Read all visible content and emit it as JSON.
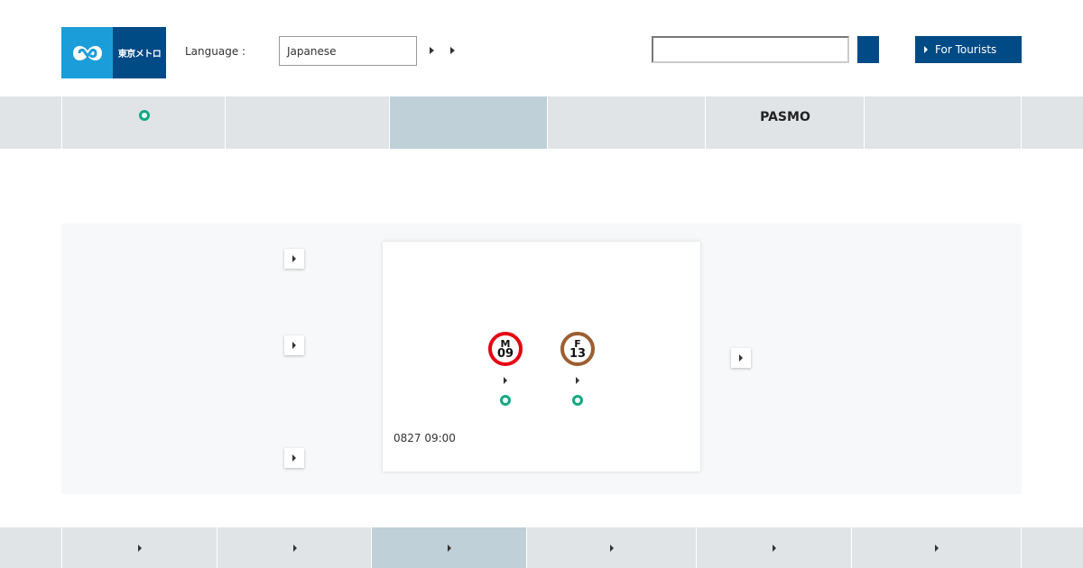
{
  "header": {
    "logo_text": "東京メトロ",
    "language_label": "Language :",
    "language_value": "Japanese",
    "search_value": "",
    "tourist_label": "For Tourists"
  },
  "nav": {
    "items": [
      {
        "label": "",
        "icon": "ring-icon"
      },
      {
        "label": ""
      },
      {
        "label": "",
        "active": true
      },
      {
        "label": ""
      },
      {
        "label": "PASMO"
      },
      {
        "label": ""
      }
    ]
  },
  "card": {
    "stations": [
      {
        "line": "M",
        "number": "09",
        "color": "#e60012"
      },
      {
        "line": "F",
        "number": "13",
        "color": "#9c5e31"
      }
    ],
    "timestamp": "0827 09:00"
  },
  "colors": {
    "brand_blue": "#004a85",
    "logo_cyan": "#1b9dd9",
    "status_green": "#13a884",
    "nav_bg": "#e0e4e7",
    "nav_active": "#bfd0d8"
  }
}
